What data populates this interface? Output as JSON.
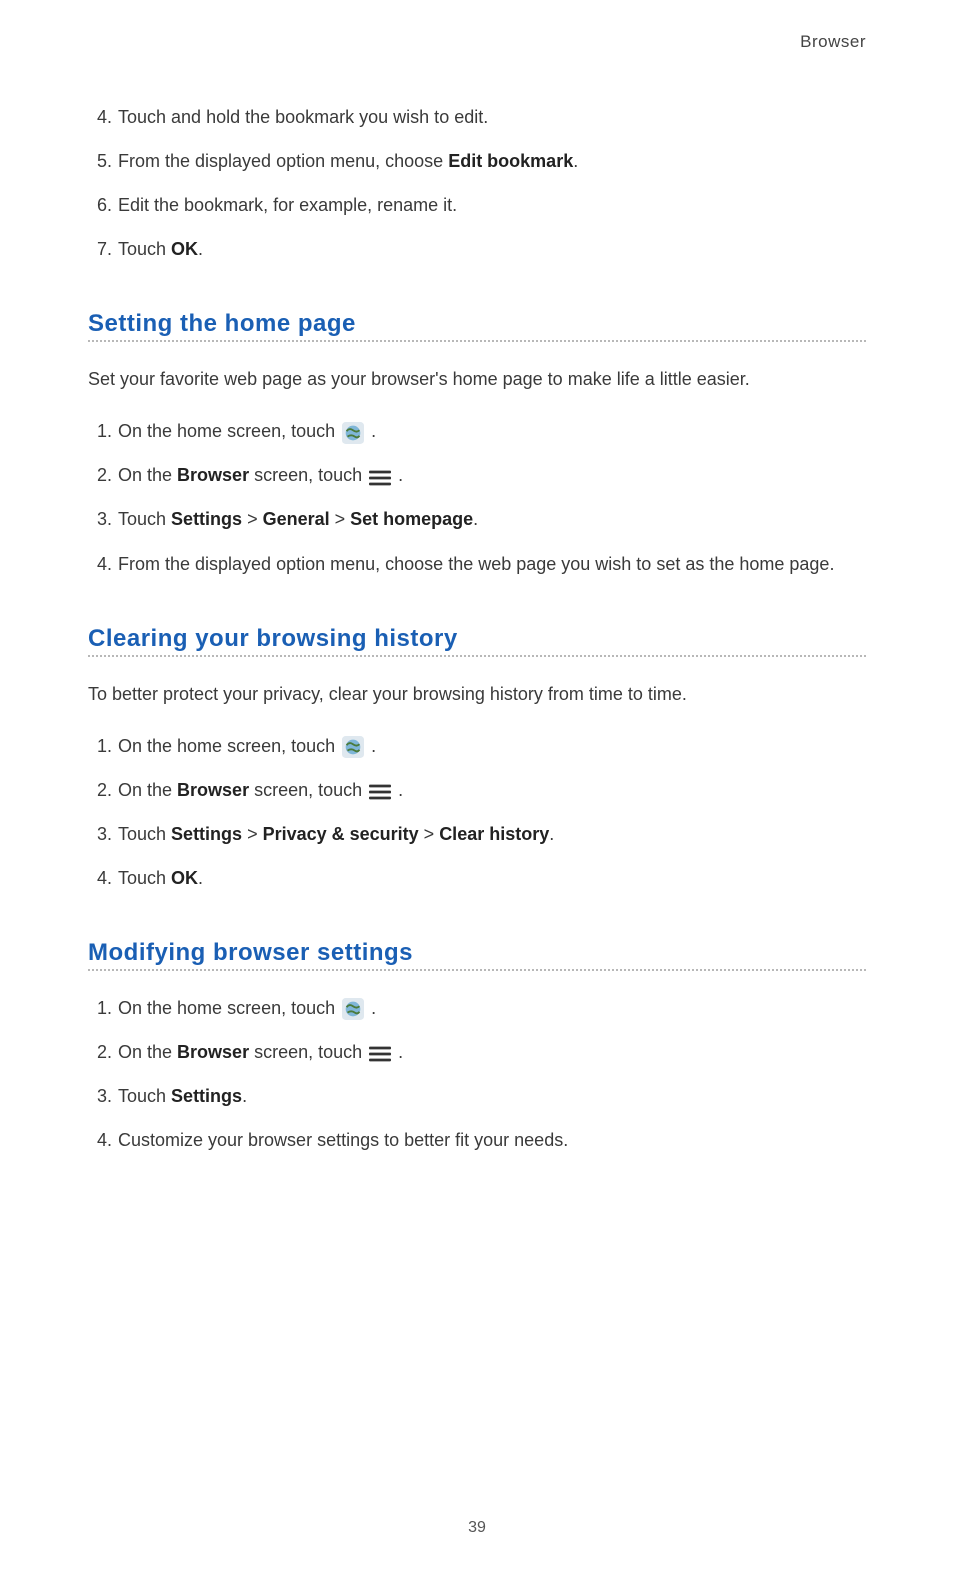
{
  "header": {
    "title": "Browser"
  },
  "top_steps": [
    {
      "n": "4.",
      "text_before": "Touch and hold the bookmark you wish to edit."
    },
    {
      "n": "5.",
      "text_before": "From the displayed option menu, choose ",
      "bold": "Edit bookmark",
      "text_after": "."
    },
    {
      "n": "6.",
      "text_before": "Edit the bookmark, for example, rename it."
    },
    {
      "n": "7.",
      "text_before": "Touch ",
      "bold": "OK",
      "text_after": "."
    }
  ],
  "sections": {
    "homepage": {
      "heading": "Setting the home page",
      "intro": "Set your favorite web page as your browser's home page to make life a little easier.",
      "steps": {
        "s1": {
          "n": "1.",
          "pre": "On the home screen, touch ",
          "post": "."
        },
        "s2": {
          "n": "2.",
          "pre": "On the ",
          "bold1": "Browser",
          "mid": " screen, touch ",
          "post": "."
        },
        "s3": {
          "n": "3.",
          "pre": "Touch ",
          "b1": "Settings",
          "sep1": " > ",
          "b2": "General",
          "sep2": " > ",
          "b3": "Set homepage",
          "post": "."
        },
        "s4": {
          "n": "4.",
          "text": "From the displayed option menu, choose the web page you wish to set as the home page."
        }
      }
    },
    "history": {
      "heading": "Clearing your browsing history",
      "intro": "To better protect your privacy, clear your browsing history from time to time.",
      "steps": {
        "s1": {
          "n": "1.",
          "pre": "On the home screen, touch ",
          "post": "."
        },
        "s2": {
          "n": "2.",
          "pre": "On the ",
          "bold1": "Browser",
          "mid": " screen, touch ",
          "post": "."
        },
        "s3": {
          "n": "3.",
          "pre": "Touch ",
          "b1": "Settings",
          "sep1": " > ",
          "b2": "Privacy & security",
          "sep2": " > ",
          "b3": "Clear history",
          "post": "."
        },
        "s4": {
          "n": "4.",
          "pre": "Touch ",
          "bold": "OK",
          "post": "."
        }
      }
    },
    "modify": {
      "heading": "Modifying browser settings",
      "steps": {
        "s1": {
          "n": "1.",
          "pre": "On the home screen, touch ",
          "post": "."
        },
        "s2": {
          "n": "2.",
          "pre": "On the ",
          "bold1": "Browser",
          "mid": " screen, touch ",
          "post": "."
        },
        "s3": {
          "n": "3.",
          "pre": "Touch ",
          "b1": "Settings",
          "post": "."
        },
        "s4": {
          "n": "4.",
          "text": "Customize your browser settings to better fit your needs."
        }
      }
    }
  },
  "page_number": "39"
}
